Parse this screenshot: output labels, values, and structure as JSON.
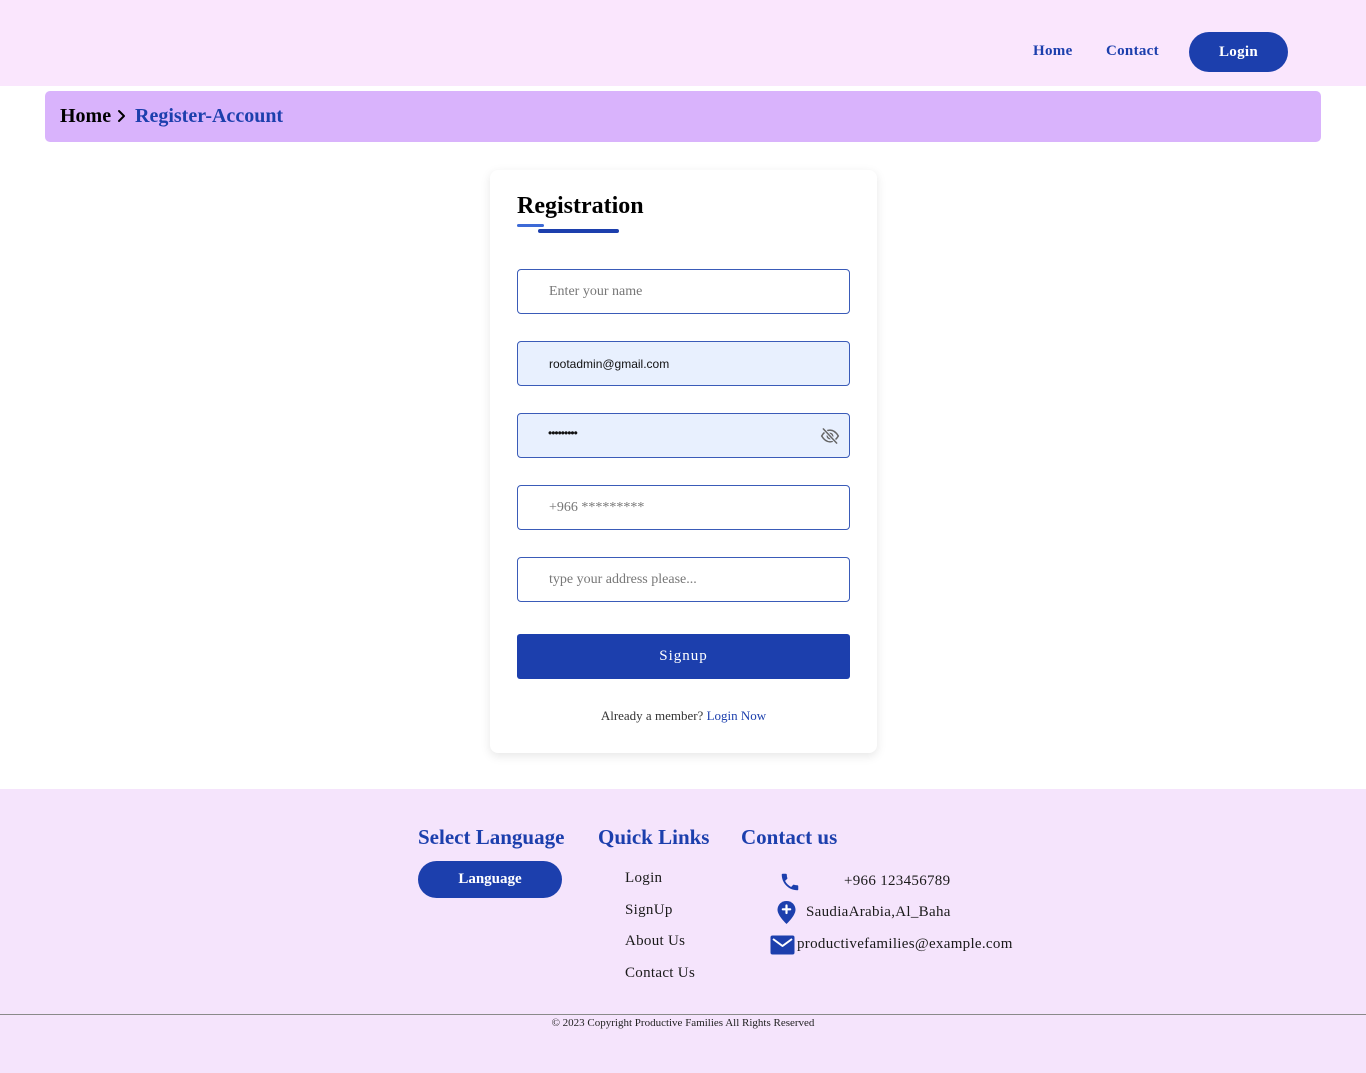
{
  "header": {
    "nav": {
      "home": "Home",
      "contact": "Contact"
    },
    "login_label": "Login"
  },
  "breadcrumb": {
    "home": "Home",
    "current": "Register-Account"
  },
  "form": {
    "title": "Registration",
    "name_placeholder": "Enter your name",
    "email_value": "rootadmin@gmail.com",
    "password_masked": "•••••••••",
    "phone_placeholder": "+966 *********",
    "address_placeholder": "type your address please...",
    "signup_label": "Signup",
    "member_text": "Already a member?",
    "login_now": "Login Now"
  },
  "footer": {
    "language": {
      "heading": "Select Language",
      "button": "Language"
    },
    "quick_links": {
      "heading": "Quick Links",
      "items": [
        "Login",
        "SignUp",
        "About Us",
        "Contact Us"
      ]
    },
    "contact": {
      "heading": "Contact us",
      "phone": "+966 123456789",
      "address": "SaudiaArabia,Al_Baha",
      "email": "productivefamilies@example.com"
    },
    "copyright": "© 2023 Copyright Productive Families All Rights Reserved"
  },
  "colors": {
    "accent": "#1c3fad",
    "header_bg": "#fae6fd",
    "breadcrumb_bg": "#d9b3fc",
    "footer_bg": "#f5e4fc",
    "autofill_bg": "#e8f0fe"
  },
  "icons": [
    "chevron-right-icon",
    "eye-slash-icon",
    "phone-icon",
    "map-pin-icon",
    "mail-icon"
  ]
}
